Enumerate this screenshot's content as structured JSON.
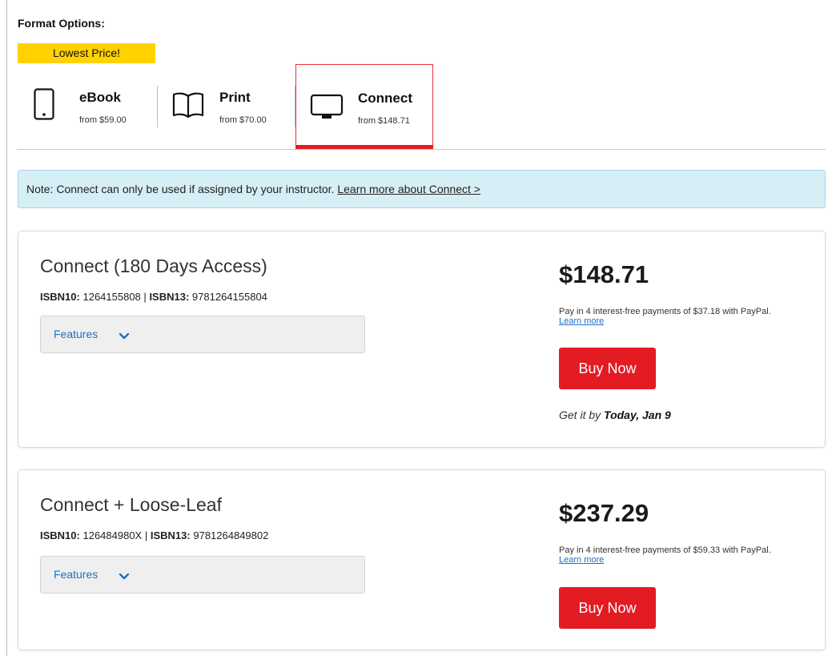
{
  "format_options": {
    "title": "Format Options:",
    "badge": "Lowest Price!",
    "tabs": [
      {
        "name": "eBook",
        "price": "from $59.00",
        "icon": "tablet-icon"
      },
      {
        "name": "Print",
        "price": "from $70.00",
        "icon": "open-book-icon"
      },
      {
        "name": "Connect",
        "price": "from $148.71",
        "icon": "monitor-icon",
        "selected": true
      }
    ]
  },
  "note": {
    "text": "Note: Connect can only be used if assigned by your instructor. ",
    "link": "Learn more about Connect >"
  },
  "products": [
    {
      "title": "Connect (180 Days Access)",
      "isbn10_label": "ISBN10:",
      "isbn10": "1264155808",
      "isbn13_label": "ISBN13:",
      "isbn13": "9781264155804",
      "features_label": "Features",
      "price": "$148.71",
      "paypal_text": "Pay in 4 interest-free payments of $37.18 with PayPal.",
      "paypal_link": "Learn more",
      "buy_label": "Buy Now",
      "delivery_prefix": "Get it by ",
      "delivery_date": "Today, Jan 9"
    },
    {
      "title": "Connect + Loose-Leaf",
      "isbn10_label": "ISBN10:",
      "isbn10": "126484980X",
      "isbn13_label": "ISBN13:",
      "isbn13": "9781264849802",
      "features_label": "Features",
      "price": "$237.29",
      "paypal_text": "Pay in 4 interest-free payments of $59.33 with PayPal.",
      "paypal_link": "Learn more",
      "buy_label": "Buy Now"
    }
  ],
  "colors": {
    "accent_red": "#e31b23",
    "badge_yellow": "#ffd200",
    "note_bg": "#d6eef5",
    "link_blue": "#1f6fc5"
  }
}
